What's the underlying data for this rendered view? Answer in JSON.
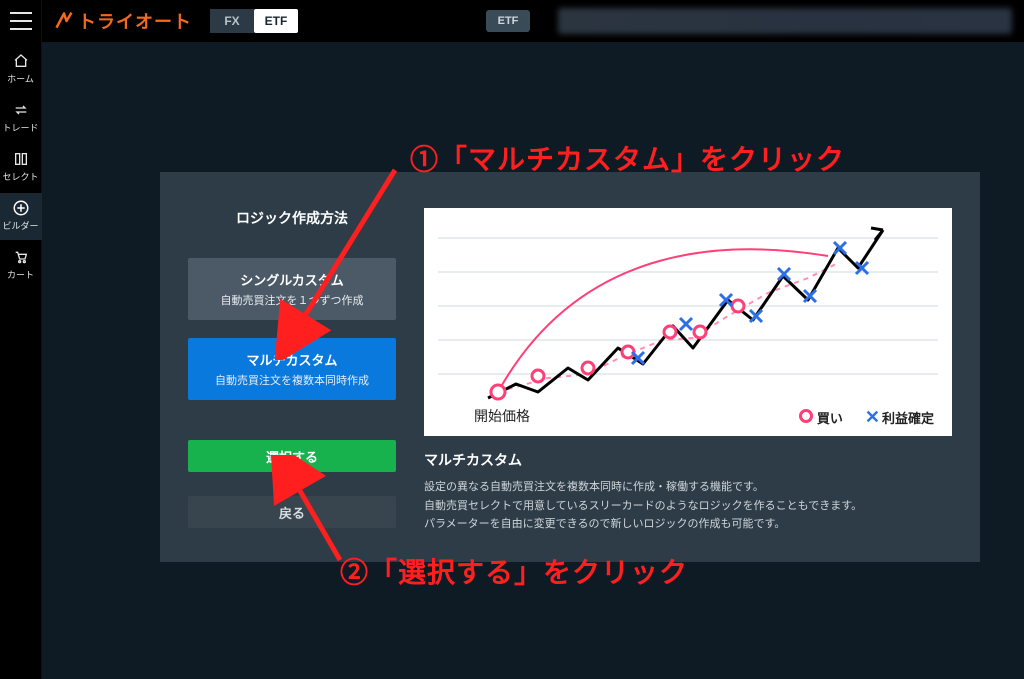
{
  "brand": "トライオート",
  "header": {
    "tabs": {
      "fx": "FX",
      "etf": "ETF",
      "active": "etf"
    },
    "chip": "ETF"
  },
  "sidebar": {
    "home": "ホーム",
    "trade": "トレード",
    "select": "セレクト",
    "builder": "ビルダー",
    "cart": "カート"
  },
  "panel": {
    "section_title": "ロジック作成方法",
    "single": {
      "title": "シングルカスタム",
      "subtitle": "自動売買注文を１つずつ作成"
    },
    "multi": {
      "title": "マルチカスタム",
      "subtitle": "自動売買注文を複数本同時作成"
    },
    "select_btn": "選択する",
    "back_btn": "戻る"
  },
  "chart": {
    "start_label": "開始価格",
    "legend_buy": "買い",
    "legend_take": "利益確定"
  },
  "desc": {
    "title": "マルチカスタム",
    "line1": "設定の異なる自動売買注文を複数本同時に作成・稼働する機能です。",
    "line2": "自動売買セレクトで用意しているスリーカードのようなロジックを作ることもできます。",
    "line3": "パラメーターを自由に変更できるので新しいロジックの作成も可能です。"
  },
  "anno": {
    "step1": "①「マルチカスタム」をクリック",
    "step2": "②「選択する」をクリック"
  }
}
